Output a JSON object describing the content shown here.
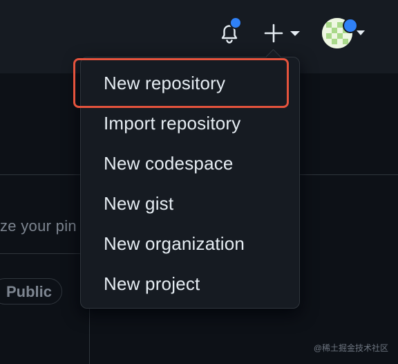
{
  "header": {
    "notifications": {
      "icon": "bell-icon",
      "has_unread": true
    },
    "create_button": {
      "icon": "plus-icon",
      "caret": "caret-down-icon"
    },
    "user_menu": {
      "icon": "avatar",
      "has_status": true
    }
  },
  "background": {
    "pins_hint_text": "ze your pin",
    "visibility_badge": "Public"
  },
  "create_menu": {
    "items": [
      {
        "label": "New repository",
        "highlighted": true
      },
      {
        "label": "Import repository"
      },
      {
        "label": "New codespace"
      },
      {
        "label": "New gist"
      },
      {
        "label": "New organization"
      },
      {
        "label": "New project"
      }
    ]
  },
  "watermark": "@稀土掘金技术社区",
  "colors": {
    "header_bg": "#161b22",
    "page_bg": "#0d1117",
    "menu_bg": "#161b22",
    "border": "#30363d",
    "text": "#e6edf3",
    "notification_dot": "#2f81f7",
    "highlight_outline": "#e5533d"
  }
}
